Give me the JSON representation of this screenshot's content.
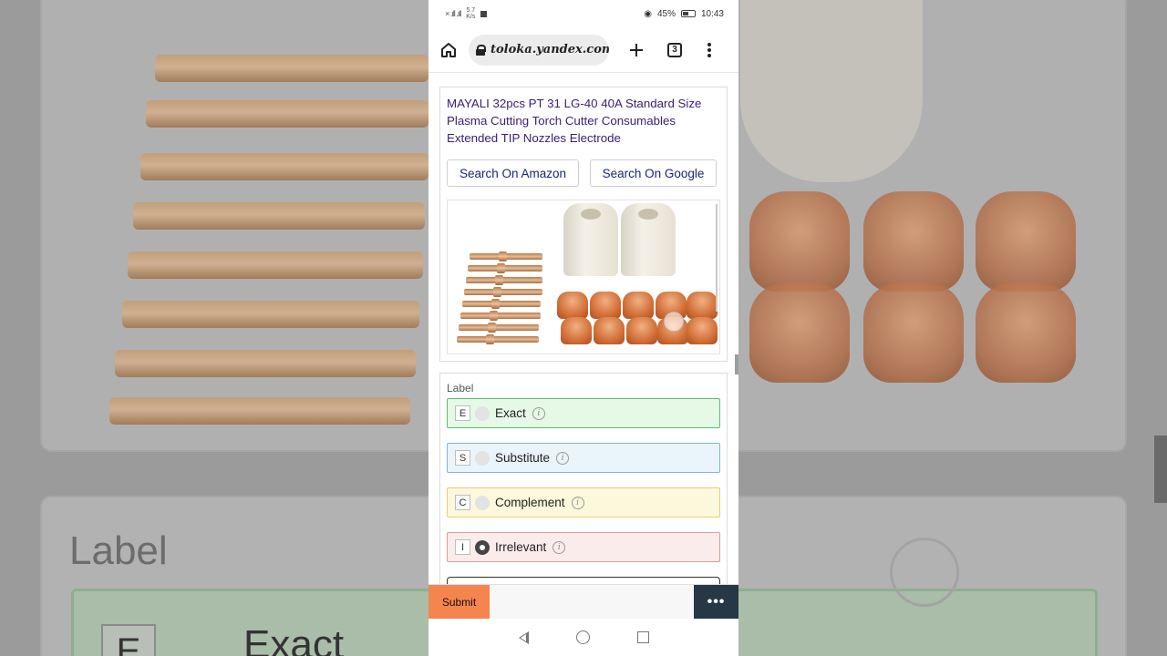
{
  "status_bar": {
    "left_signal": "× .ıll .ıll",
    "net_speed": "5.7",
    "net_unit": "K/s",
    "battery": "45%",
    "time": "10:43"
  },
  "browser": {
    "url": "toloka.yandex.com",
    "tab_count": "3",
    "icons": [
      "home-icon",
      "lock-icon",
      "plus-icon",
      "tabs-icon",
      "more-vert-icon"
    ]
  },
  "product": {
    "title": "MAYALI 32pcs PT 31 LG-40 40A Standard Size Plasma Cutting Torch Cutter Consumables Extended TIP Nozzles Electrode",
    "search_amazon": "Search On Amazon",
    "search_google": "Search On Google"
  },
  "label_section": {
    "caption": "Label",
    "options": [
      {
        "key": "E",
        "label": "Exact",
        "selected": false,
        "color": "#e6f9e7"
      },
      {
        "key": "S",
        "label": "Substitute",
        "selected": false,
        "color": "#e9f4fb"
      },
      {
        "key": "C",
        "label": "Complement",
        "selected": false,
        "color": "#fdf7dc"
      },
      {
        "key": "I",
        "label": "Irrelevant",
        "selected": true,
        "color": "#fbecec"
      }
    ]
  },
  "bottom_bar": {
    "submit_label": "Submit",
    "more_label": "•••"
  },
  "background": {
    "label": "Label",
    "opt_key": "E",
    "opt_label": "Exact"
  }
}
